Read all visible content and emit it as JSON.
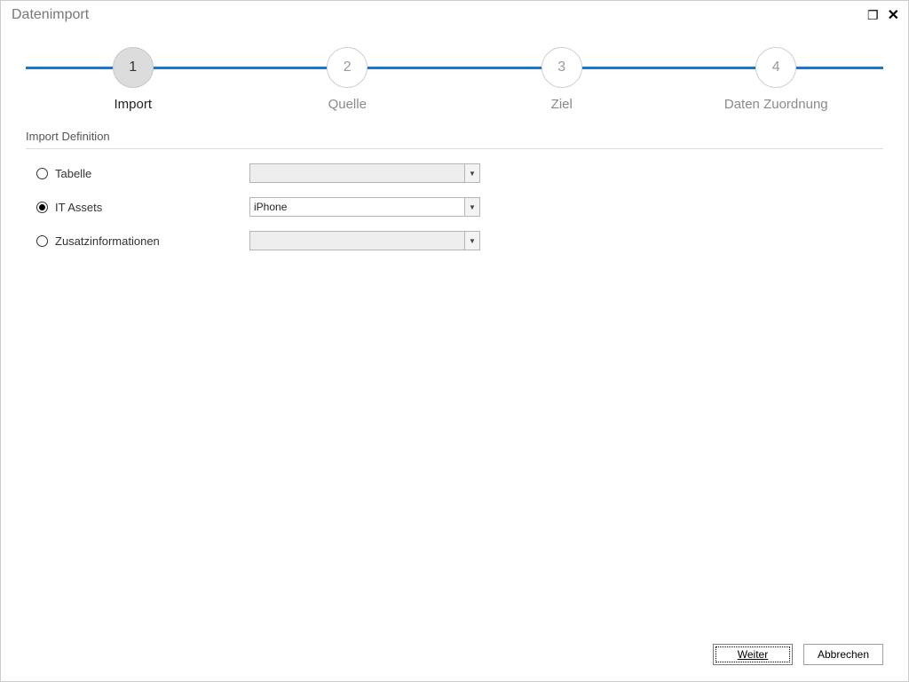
{
  "window": {
    "title": "Datenimport"
  },
  "steps": {
    "items": [
      {
        "num": "1",
        "label": "Import"
      },
      {
        "num": "2",
        "label": "Quelle"
      },
      {
        "num": "3",
        "label": "Ziel"
      },
      {
        "num": "4",
        "label": "Daten Zuordnung"
      }
    ]
  },
  "section": {
    "title": "Import Definition"
  },
  "options": {
    "tabelle": {
      "label": "Tabelle",
      "value": ""
    },
    "itassets": {
      "label": "IT Assets",
      "value": "iPhone"
    },
    "zusatz": {
      "label": "Zusatzinformationen",
      "value": ""
    }
  },
  "footer": {
    "next": "Weiter",
    "cancel": "Abbrechen"
  }
}
